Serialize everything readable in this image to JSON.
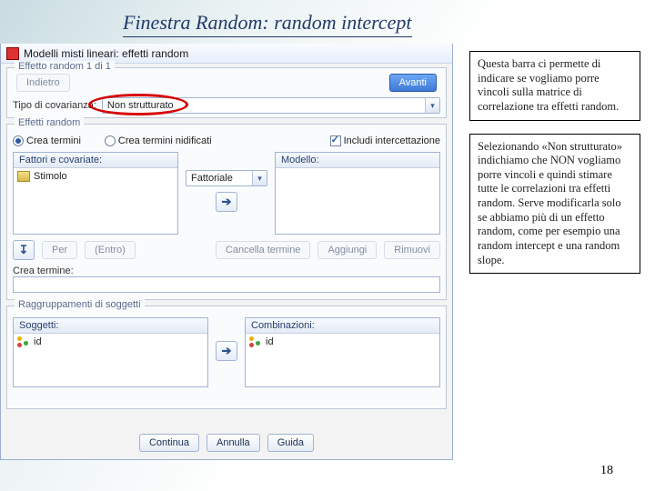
{
  "slide": {
    "title": "Finestra Random: random intercept",
    "page_number": "18"
  },
  "dialog": {
    "window_title": "Modelli misti lineari: effetti random",
    "top": {
      "legend": "Effetto random 1 di 1",
      "back": "Indietro",
      "forward": "Avanti",
      "cov_label": "Tipo di covarianza:",
      "cov_value": "Non strutturato"
    },
    "mid": {
      "legend": "Effetti random",
      "radio_build": "Crea termini",
      "radio_nested": "Crea termini nidificati",
      "check_intercept": "Includi intercettazione",
      "factors_header": "Fattori e covariate:",
      "model_header": "Modello:",
      "factor_item": "Stimolo",
      "interaction_label": "Fattoriale",
      "by": "Per",
      "within": "(Entro)",
      "cancel_term": "Cancella termine",
      "add": "Aggiungi",
      "remove": "Rimuovi",
      "build_term_lbl": "Crea termine:"
    },
    "bot": {
      "legend": "Raggruppamenti di soggetti",
      "subjects_header": "Soggetti:",
      "combos_header": "Combinazioni:",
      "item": "id"
    },
    "footer": {
      "continue": "Continua",
      "cancel": "Annulla",
      "help": "Guida"
    }
  },
  "callouts": {
    "box1": "Questa barra ci permette di indicare se vogliamo porre vincoli sulla matrice di correlazione tra effetti random.",
    "box2": "Selezionando «Non strutturato» indichiamo che NON vogliamo porre vincoli e quindi stimare tutte le correlazioni tra effetti random. Serve modificarla solo se abbiamo più di un effetto random, come per esempio una random intercept e una random slope."
  }
}
